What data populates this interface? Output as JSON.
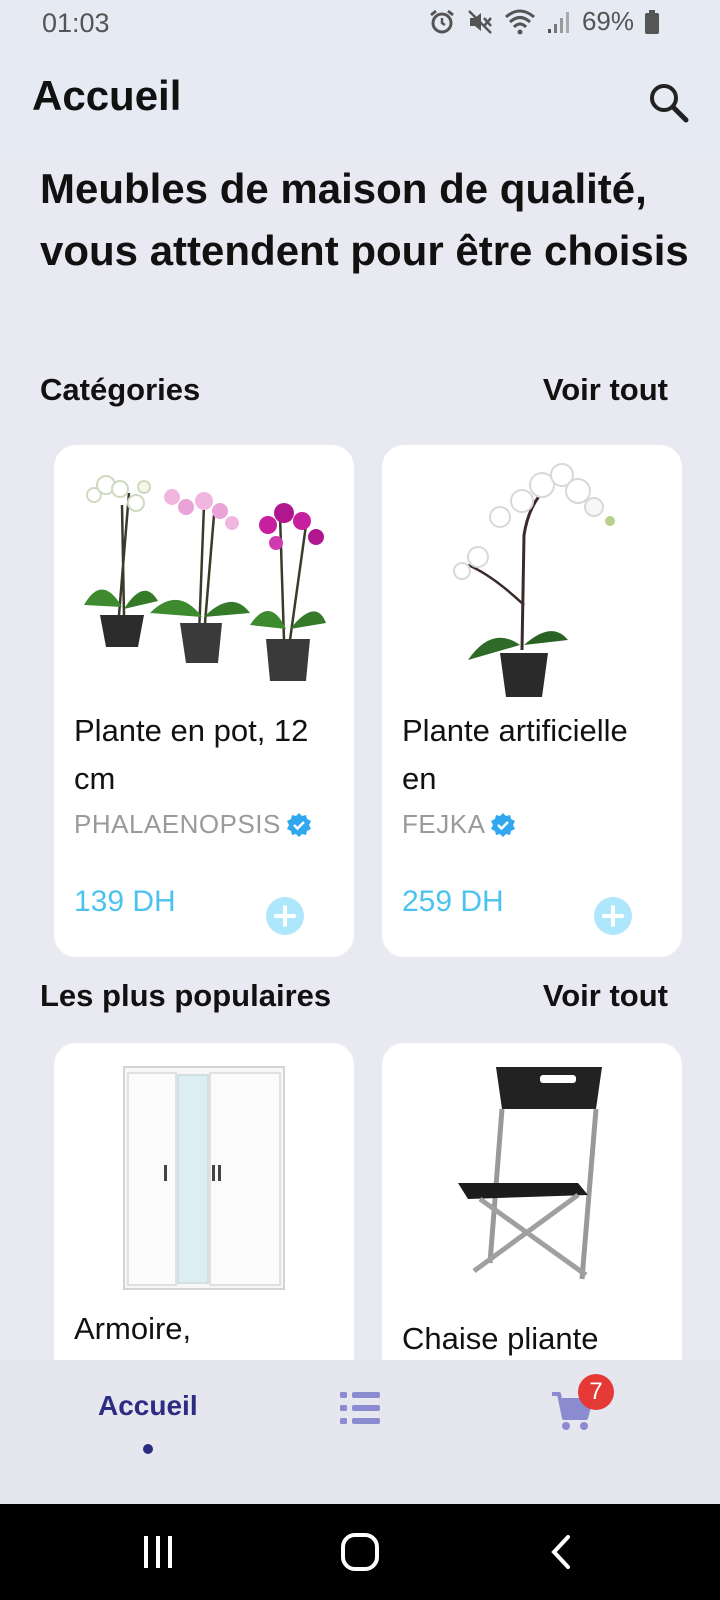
{
  "status_bar": {
    "time": "01:03",
    "battery": "69%"
  },
  "app_bar": {
    "title": "Accueil"
  },
  "headline": "Meubles de maison de qualité, vous attendent pour être choisis",
  "categories": {
    "title": "Catégories",
    "see_all": "Voir tout",
    "items": [
      {
        "name": "Plante en pot, 12 cm",
        "brand": "PHALAENOPSIS",
        "price": "139 DH"
      },
      {
        "name": "Plante artificielle en",
        "brand": "FEJKA",
        "price": "259 DH"
      }
    ]
  },
  "popular": {
    "title": "Les plus populaires",
    "see_all": "Voir tout",
    "items": [
      {
        "name": "Armoire,"
      },
      {
        "name": "Chaise pliante"
      }
    ]
  },
  "bottom_nav": {
    "home_label": "Accueil",
    "cart_count": "7"
  },
  "colors": {
    "accent": "#4cc3ef",
    "nav_active": "#2c2c82",
    "nav_inactive": "#8b8bcf",
    "badge": "#e53935",
    "verified": "#2fa8f0"
  }
}
